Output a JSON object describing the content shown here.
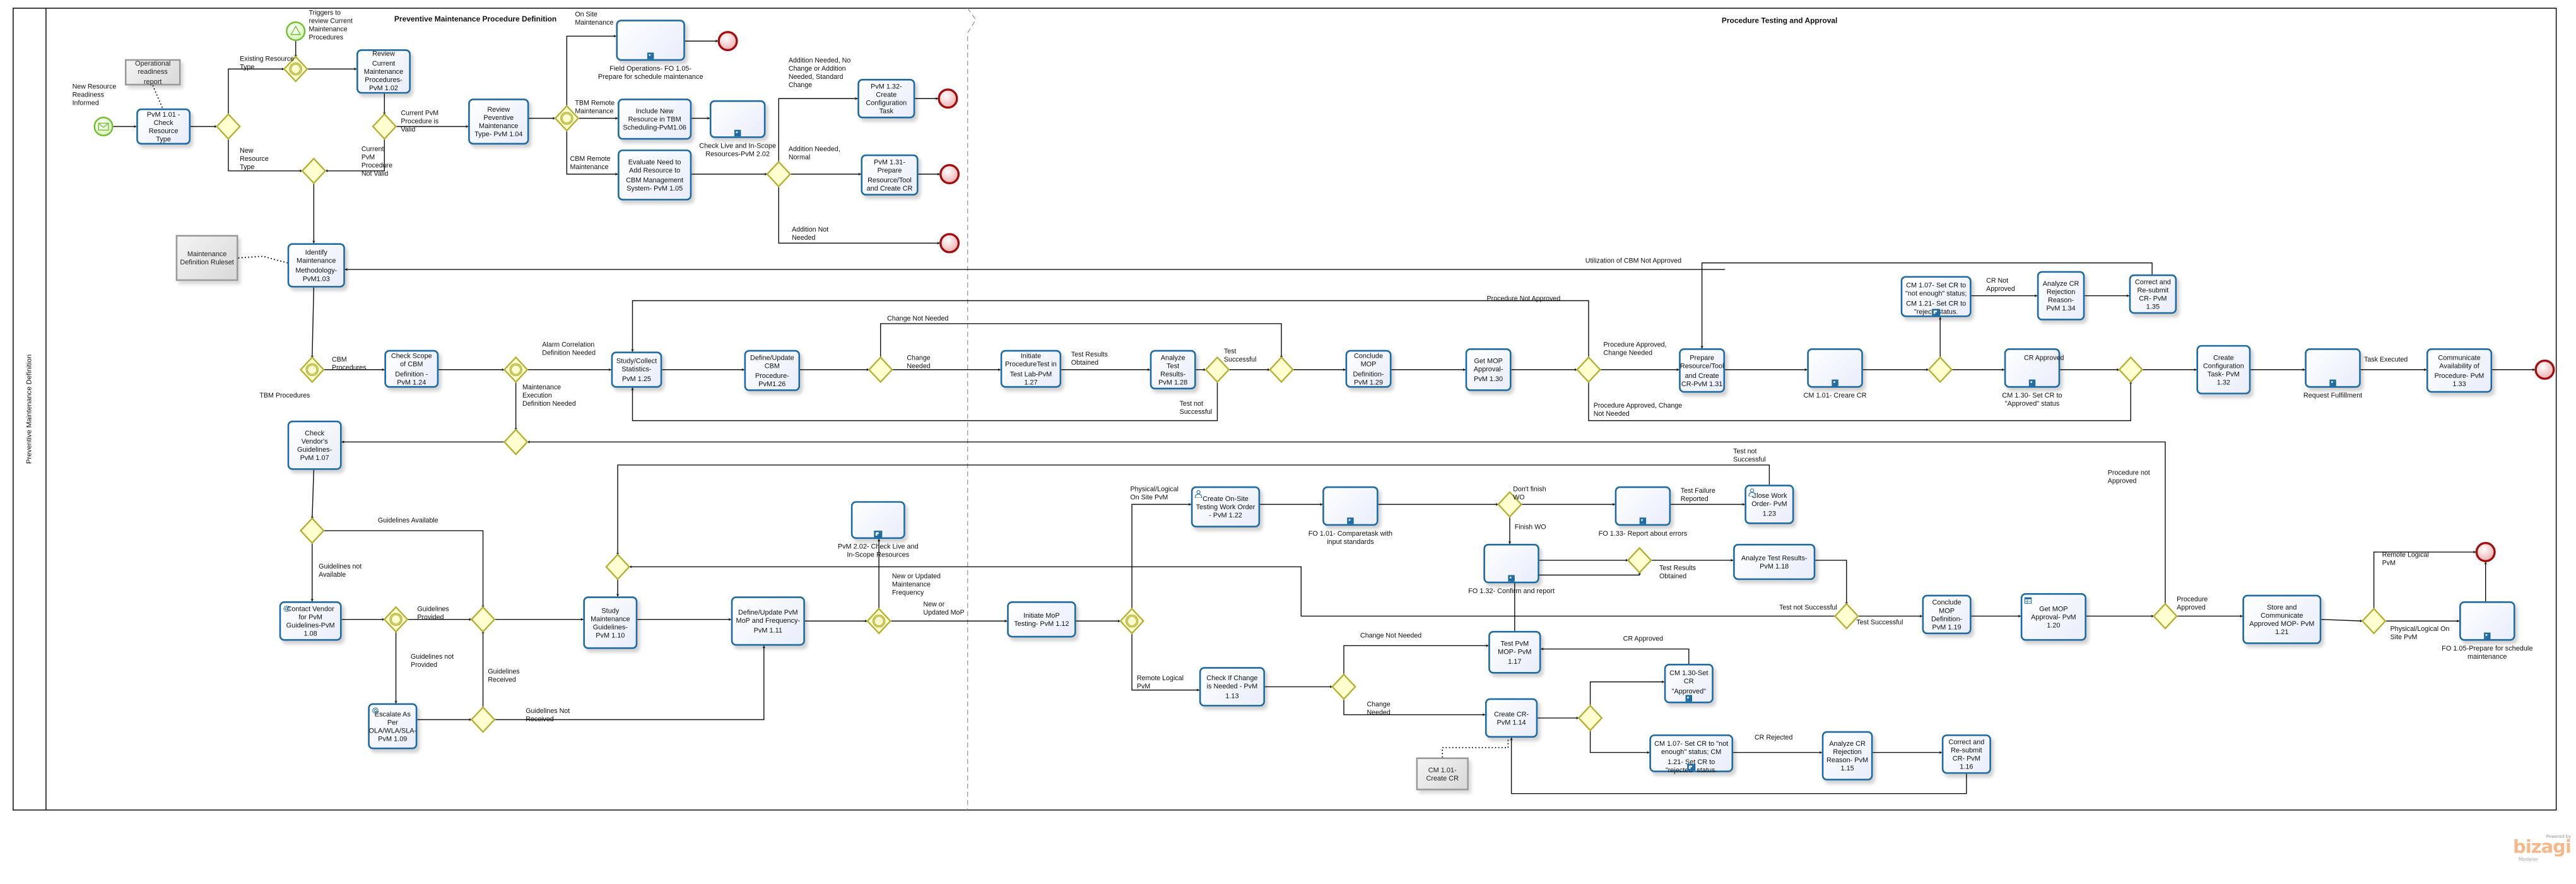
{
  "pool": {
    "lane_title": "Preventive Maintenance Definition",
    "phases": [
      "Preventive Maintenance Procedure Definition",
      "Procedure Testing and Approval"
    ]
  },
  "colors": {
    "task_border": "#1e6aa2",
    "gateway": "#b3b030",
    "gateway_fill": "#ffffd0",
    "start_event": "#6cbf2a",
    "end_event": "#a30d0d",
    "annotation": "#d9d9d9"
  },
  "events": {
    "s1": {
      "type": "message-start-event"
    },
    "s2": {
      "type": "signal-start-event"
    },
    "e1": {
      "type": "end-event"
    },
    "e2": {
      "type": "end-event"
    },
    "e3": {
      "type": "end-event"
    },
    "e4": {
      "type": "end-event"
    },
    "e5": {
      "type": "end-event"
    },
    "e6": {
      "type": "end-event"
    }
  },
  "tasks": {
    "pvm101": "PvM 1.01 - Check Resource Type",
    "pvm102": "Review Current Maintenance Procedures-PvM 1.02",
    "pvm104": "Review Peventive Maintenance Type- PvM 1.04",
    "pvm103": "Identify Maintenance Methodology- PvM1.03",
    "pvm106": "Include New Resource in TBM Scheduling-PvM1.06",
    "pvm105": "Evaluate Need to Add Resource to CBM Management System- PvM 1.05",
    "pvm132a": "PvM 1.32- Create Configuration Task",
    "pvm131a": "PvM 1.31- Prepare Resource/Tool and Create CR",
    "pvm124": "Check Scope of CBM Definition -PvM 1.24",
    "pvm125": "Study/Collect Statistics-PvM 1.25",
    "pvm126": "Define/Update CBM Procedure- PvM1.26",
    "pvm127": "Initiate ProcedureTest in Test Lab-PvM 1.27",
    "pvm128": "Analyze Test Results-PvM 1.28",
    "pvm129": "Conclude MOP Definition- PvM 1.29",
    "pvm130": "Get MOP Approval- PvM 1.30",
    "pvm131b": "Prepare Resource/Tool and Create CR-PvM 1.31",
    "pvm134": "Analyze CR Rejection Reason- PvM 1.34",
    "pvm135": "Correct and Re-submit CR- PvM 1.35",
    "pvm132b": "Create Configuration Task- PvM 1.32",
    "pvm133": "Communicate Availability of Procedure- PvM 1.33",
    "pvm107": "Check Vendor's Guidelines- PvM 1.07",
    "pvm108": "Contact Vendor for PvM Guidelines-PvM 1.08",
    "pvm109": "Escalate As Per OLA/WLA/SLA- PvM 1.09",
    "pvm110": "Study Maintenance Guidelines- PvM 1.10",
    "pvm111": "Define/Update PvM MoP and Frequency- PvM 1.11",
    "pvm112": "Initiate MoP Testing- PvM 1.12",
    "pvm122": "Create On-Site Testing Work Order - PvM 1.22",
    "pvm123": "Close Work Order- PvM 1.23",
    "pvm118": "Analyze Test Results-PvM 1.18",
    "pvm119": "Conclude MOP Definition- PvM 1.19",
    "pvm120": "Get MOP Approval- PvM 1.20",
    "pvm121": "Store and Communicate Approved MOP- PvM 1.21",
    "pvm113": "Check If Change is Needed - PvM 1.13",
    "pvm117": "Test PvM MOP- PvM 1.17",
    "pvm114": "Create CR- PvM 1.14",
    "pvm115": "Analyze CR Rejection Reason- PvM 1.15",
    "pvm116": "Correct and Re-submit CR- PvM 1.16"
  },
  "task_icons": {
    "pvm108": "gear-icon",
    "pvm109": "gear-icon",
    "pvm122": "user-icon",
    "pvm123": "user-icon",
    "pvm120": "table-icon"
  },
  "subprocesses": {
    "fo105a": "Field Operations- FO 1.05- Prepare for schedule maintenance",
    "pvm202a": "Check Live and In-Scope Resources-PvM 2.02",
    "cm101a": "CM 1.01- Creare CR",
    "cm130a": "CM 1.30- Set CR to \"Approved\" status",
    "cm107a": "CM 1.07- Set CR to \"not enough\" status; CM 1.21- Set CR to \"reject\" status.",
    "reqful": "Request Fulfillment",
    "pvm202b": "PvM 2.02- Check Live and In-Scope Resources",
    "fo101": "FO 1.01- Comparetask with input standards",
    "fo133": "FO 1.33- Report about errors",
    "fo132": "FO 1.32- Confirm and report",
    "cm130b": "CM 1.30-Set CR \"Approved\"",
    "cm107b": "CM 1.07- Set CR to \"not enough\" status; CM 1.21- Set CR to \"rejected\" status.",
    "fo105b": "FO 1.05-Prepare for schedule maintenance"
  },
  "annotations": {
    "ann_ops": "Operational readiness report",
    "ann_rules": "Maintenance Definition Ruleset",
    "ann_cm101": "CM 1.01- Create CR"
  },
  "flow_labels": {
    "new_resource_informed": "New Resource Readiness Informed",
    "triggers": "Triggers to review Current Maintenance Procedures",
    "existing_type": "Existing Resource Type",
    "new_type": "New Resource Type",
    "valid": "Current PvM Procedure is Valid",
    "not_valid": "Current PvM Procedure Not Valid",
    "on_site": "On Site Maintenance",
    "tbm_remote": "TBM Remote Maintenance",
    "cbm_remote": "CBM Remote Maintenance",
    "add_std": "Addition Needed, No Change or Addition Needed, Standard Change",
    "add_normal": "Addition Needed, Normal",
    "add_not": "Addition Not Needed",
    "cbm_proc": "CBM Procedures",
    "tbm_proc": "TBM Procedures",
    "alarm": "Alarm Correlation Definition Needed",
    "maint_exec": "Maintenance Execution Definition Needed",
    "change_not_needed1": "Change Not Needed",
    "change_needed1": "Change Needed",
    "test_results1": "Test Results Obtained",
    "test_succ1": "Test Successful",
    "test_not1": "Test not Successful",
    "proc_not_approved1": "Procedure Not Approved",
    "proc_appr_change": "Procedure Approved, Change Needed",
    "proc_appr_nochange": "Procedure Approved, Change Not Needed",
    "utilization": "Utilization of CBM Not Approved",
    "cr_not_approved": "CR Not Approved",
    "cr_approved1": "CR Approved",
    "task_exec": "Task Executed",
    "guidelines_avail": "Guidelines Available",
    "guidelines_not_avail": "Guidelines not Available",
    "guidelines_prov": "Guidelines Provided",
    "guidelines_not_prov": "Guidelines not Provided",
    "guidelines_recv": "Guidelines Received",
    "guidelines_not_recv": "Guidelines Not Received",
    "new_upd_freq": "New or Updated Maintenance Frequency",
    "new_upd_mop": "New or Updated MoP",
    "phys_onsite1": "Physical/Logical On Site PvM",
    "remote_logical1": "Remote Logical PvM",
    "dont_finish": "Don't finish WO",
    "finish_wo": "Finish WO",
    "test_fail_rep": "Test Failure Reported",
    "test_not2": "Test not Successful",
    "test_results2": "Test Results Obtained",
    "test_not3": "Test not Successful",
    "test_succ2": "Test Successful",
    "proc_not_approved2": "Procedure not Approved",
    "proc_approved": "Procedure Approved",
    "remote_logical2": "Remote Logical PvM",
    "phys_onsite2": "Physical/Logical On Site PvM",
    "change_not_needed2": "Change Not Needed",
    "change_needed2": "Change Needed",
    "cr_approved2": "CR Approved",
    "cr_rejected": "CR Rejected"
  },
  "logo": {
    "powered_by": "Powered by",
    "brand": "bizagi",
    "product": "Modeler"
  }
}
